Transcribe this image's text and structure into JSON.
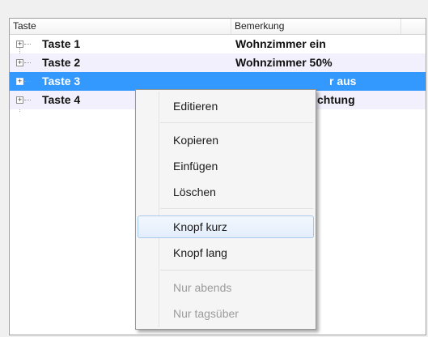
{
  "listview": {
    "columns": [
      "Taste",
      "Bemerkung"
    ],
    "rows": [
      {
        "key": "Taste 1",
        "remark": "Wohnzimmer ein",
        "selected": false
      },
      {
        "key": "Taste 2",
        "remark": "Wohnzimmer 50%",
        "selected": false
      },
      {
        "key": "Taste 3",
        "remark": "r aus",
        "selected": true
      },
      {
        "key": "Taste 4",
        "remark": "chtung",
        "selected": false
      }
    ]
  },
  "context_menu": {
    "items": [
      {
        "label": "Editieren",
        "enabled": true,
        "highlighted": false
      },
      {
        "label": "Kopieren",
        "enabled": true,
        "highlighted": false
      },
      {
        "label": "Einfügen",
        "enabled": true,
        "highlighted": false
      },
      {
        "label": "Löschen",
        "enabled": true,
        "highlighted": false
      },
      {
        "label": "Knopf kurz",
        "enabled": true,
        "highlighted": true
      },
      {
        "label": "Knopf lang",
        "enabled": true,
        "highlighted": false
      },
      {
        "label": "Nur abends",
        "enabled": false,
        "highlighted": false
      },
      {
        "label": "Nur tagsüber",
        "enabled": false,
        "highlighted": false
      }
    ]
  },
  "colors": {
    "selection": "#3399ff",
    "alt_row": "#f2f0fc",
    "menu_background": "#f5f5f5",
    "disabled_text": "#9b9b9b"
  },
  "icons": {
    "expander": "plus-box-icon"
  }
}
